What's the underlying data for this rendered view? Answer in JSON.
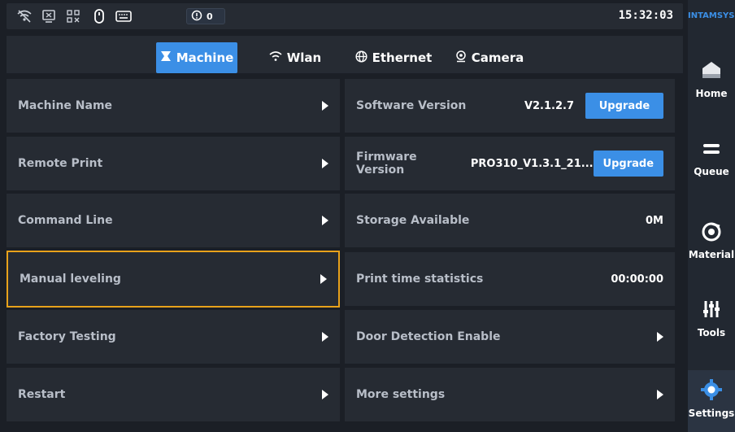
{
  "status_bar": {
    "icons": [
      "wifi-off-icon",
      "usb-device-icon",
      "network-disconnected-icon",
      "mouse-icon",
      "keyboard-icon"
    ],
    "alert_count": "0",
    "clock": "15:32:03"
  },
  "tabs": [
    {
      "label": "Machine",
      "icon": "machine-icon",
      "active": true
    },
    {
      "label": "Wlan",
      "icon": "wifi-icon",
      "active": false
    },
    {
      "label": "Ethernet",
      "icon": "globe-icon",
      "active": false
    },
    {
      "label": "Camera",
      "icon": "camera-icon",
      "active": false
    }
  ],
  "left_rows": [
    {
      "label": "Machine Name"
    },
    {
      "label": "Remote Print"
    },
    {
      "label": "Command Line"
    },
    {
      "label": "Manual leveling",
      "selected": true
    },
    {
      "label": "Factory Testing"
    },
    {
      "label": "Restart"
    }
  ],
  "right_rows": [
    {
      "label": "Software Version",
      "value": "V2.1.2.7",
      "button": "Upgrade"
    },
    {
      "label": "Firmware Version",
      "value": "PRO310_V1.3.1_21...",
      "button": "Upgrade"
    },
    {
      "label": "Storage Available",
      "value": "0M"
    },
    {
      "label": "Print time statistics",
      "value": "00:00:00"
    },
    {
      "label": "Door Detection Enable"
    },
    {
      "label": "More settings"
    }
  ],
  "sidebar": {
    "brand": "INTAMSYS",
    "items": [
      {
        "label": "Home",
        "icon": "home-icon"
      },
      {
        "label": "Queue",
        "icon": "queue-icon"
      },
      {
        "label": "Material",
        "icon": "material-icon"
      },
      {
        "label": "Tools",
        "icon": "tools-icon"
      },
      {
        "label": "Settings",
        "icon": "settings-icon",
        "active": true
      }
    ]
  },
  "colors": {
    "accent": "#3b8fe6",
    "selection_border": "#e8a21b",
    "background": "#1b1f26",
    "panel": "#262b33"
  }
}
